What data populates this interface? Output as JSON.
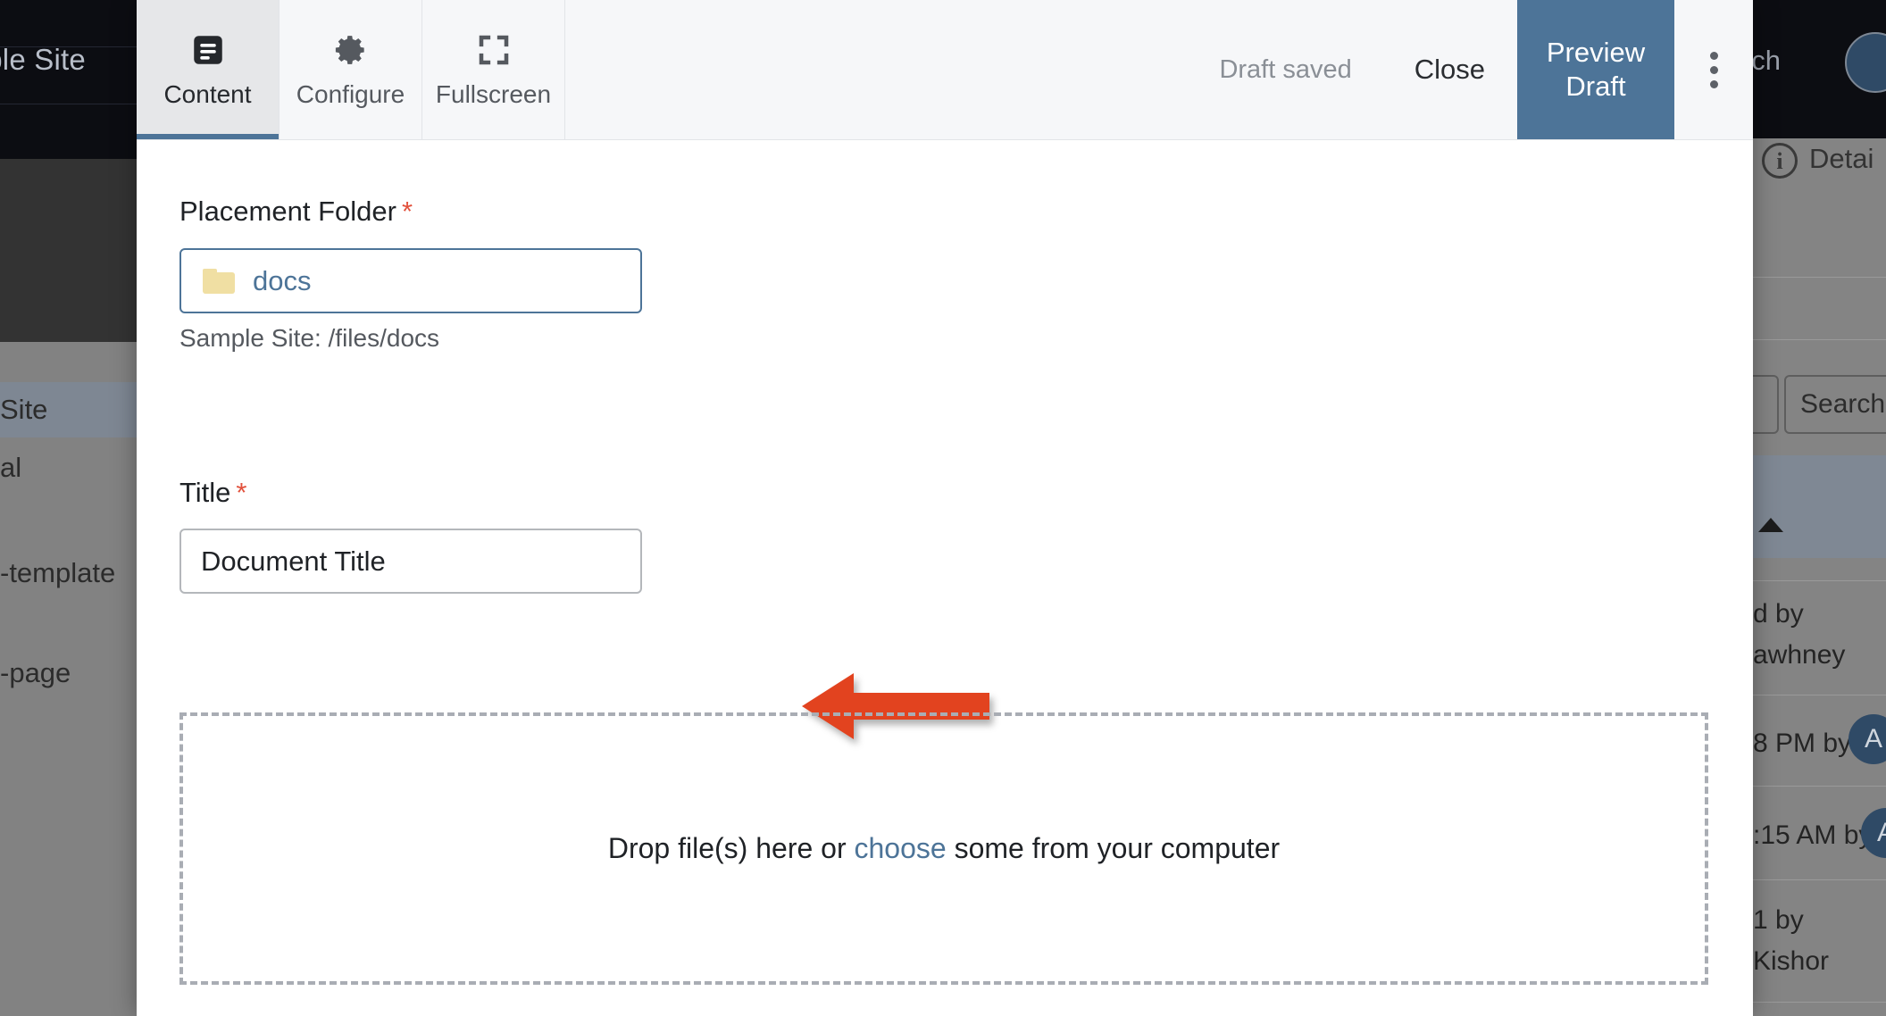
{
  "background": {
    "site_title": "ample Site",
    "search_label": "Search",
    "avatar_icon": "user-avatar",
    "sidebar_items": [
      {
        "label": "Site",
        "selected": true
      },
      {
        "label": "al",
        "selected": false
      },
      {
        "label": "-template",
        "selected": false
      },
      {
        "label": "-page",
        "selected": false
      }
    ],
    "details_panel": {
      "info_icon": "info-circle-icon",
      "title": "Detai",
      "filter_icon": "filter-icon",
      "search_placeholder": "Search",
      "sort_caret_icon": "caret-up-icon",
      "rows": [
        {
          "line1": "d by",
          "line2": "awhney",
          "avatar": ""
        },
        {
          "line1": "8 PM by",
          "line2": "",
          "avatar": "A"
        },
        {
          "line1": ":15 AM by",
          "line2": "",
          "avatar": "A"
        },
        {
          "line1": "1 by",
          "line2": "Kishor",
          "avatar": ""
        }
      ]
    }
  },
  "modal": {
    "tabs": [
      {
        "label": "Content",
        "icon": "document-lines-icon",
        "active": true
      },
      {
        "label": "Configure",
        "icon": "gear-icon",
        "active": false
      },
      {
        "label": "Fullscreen",
        "icon": "expand-icon",
        "active": false
      }
    ],
    "status_text": "Draft saved",
    "close_label": "Close",
    "preview_label": "Preview Draft",
    "overflow_icon": "kebab-menu-icon",
    "form": {
      "placement_folder": {
        "label": "Placement Folder",
        "required_marker": "*",
        "icon": "folder-icon",
        "value": "docs",
        "help_text": "Sample Site: /files/docs"
      },
      "title": {
        "label": "Title",
        "required_marker": "*",
        "value": "Document Title"
      },
      "dropzone": {
        "text_before": "Drop file(s) here or ",
        "link_text": "choose",
        "text_after": " some from your computer"
      }
    }
  },
  "annotation": {
    "arrow_icon": "left-arrow-annotation",
    "color": "#e2431f"
  },
  "colors": {
    "accent_blue": "#4d7498",
    "required_red": "#e2513c",
    "annotation_red": "#e2431f",
    "folder_yellow": "#f0dfa3",
    "dark_chrome": "#0c0d12"
  }
}
